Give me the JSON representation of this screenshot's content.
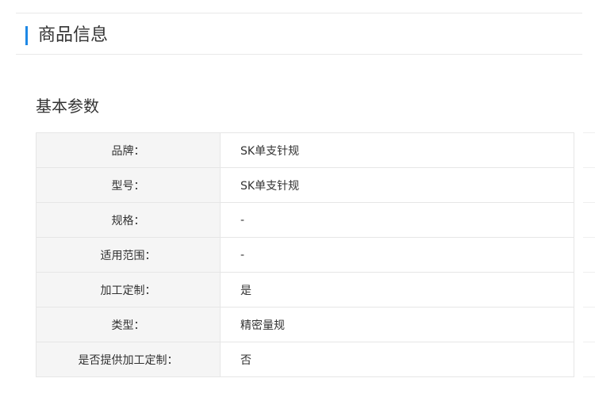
{
  "section": {
    "title": "商品信息"
  },
  "parameters": {
    "title": "基本参数",
    "rows": [
      {
        "key": "品牌：",
        "value": "SK单支针规"
      },
      {
        "key": "型号：",
        "value": "SK单支针规"
      },
      {
        "key": "规格：",
        "value": "-"
      },
      {
        "key": "适用范围：",
        "value": "-"
      },
      {
        "key": "加工定制：",
        "value": "是"
      },
      {
        "key": "类型：",
        "value": "精密量规"
      },
      {
        "key": "是否提供加工定制：",
        "value": "否"
      }
    ]
  },
  "colors": {
    "accent": "#1e88e5",
    "key_background": "#f5f5f5",
    "border": "#e6e6e6"
  }
}
